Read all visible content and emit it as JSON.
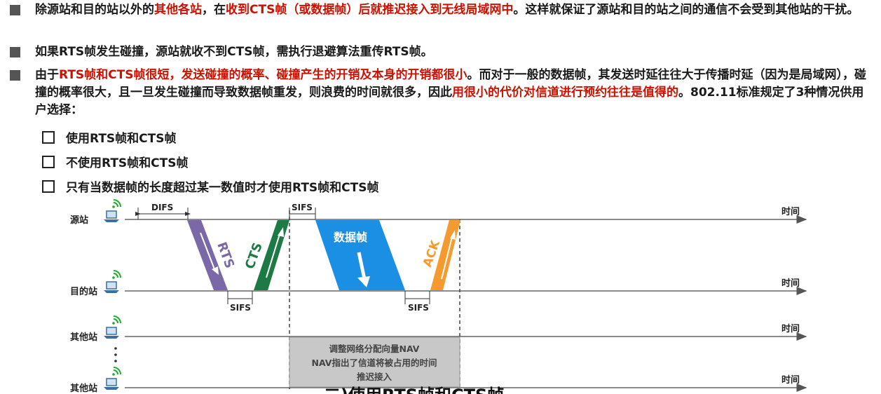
{
  "bullets": [
    {
      "parts": [
        {
          "text": "除源站和目的站以外的",
          "red": false
        },
        {
          "text": "其他各站",
          "red": true
        },
        {
          "text": "，在",
          "red": false
        },
        {
          "text": "收到CTS帧（或数据帧）后就推迟接入到无线局域网中",
          "red": true
        },
        {
          "text": "。这样就保证了源站和目的站之间的通信不会受到其他站的干扰。",
          "red": false
        }
      ]
    },
    {
      "parts": [
        {
          "text": "如果RTS帧发生碰撞，源站就收不到CTS帧，需执行退避算法重传RTS帧。",
          "red": false
        }
      ]
    },
    {
      "parts": [
        {
          "text": "由于",
          "red": false
        },
        {
          "text": "RTS帧和CTS帧很短，发送碰撞的概率、碰撞产生的开销及本身的开销都很小",
          "red": true
        },
        {
          "text": "。而对于一般的数据帧，其发送时延往往大于传播时延（因为是局域网），碰撞的概率很大，且一旦发生碰撞而导致数据帧重发，则浪费的时间就很多，因此",
          "red": false
        },
        {
          "text": "用很小的代价对信道进行预约往往是值得的",
          "red": true
        },
        {
          "text": "。802.11标准规定了3种情况供用户选择：",
          "red": false
        }
      ]
    }
  ],
  "options": [
    "使用RTS帧和CTS帧",
    "不使用RTS帧和CTS帧",
    "只有当数据帧的长度超过某一数值时才使用RTS帧和CTS帧"
  ],
  "diagram": {
    "stations": [
      "源站",
      "目的站",
      "其他站",
      "其他站"
    ],
    "time_label": "时间",
    "difs": "DIFS",
    "sifs": "SIFS",
    "frames": {
      "rts": "RTS",
      "cts": "CTS",
      "data": "数据帧",
      "ack": "ACK"
    },
    "nav_lines": [
      "调整网络分配向量NAV",
      "NAV指出了信道将被占用的时间",
      "推迟接入"
    ],
    "colors": {
      "rts": "#7b68a6",
      "cts": "#1e7a45",
      "data": "#1a8fe3",
      "ack": "#f59a2e",
      "nav": "#c8c8c8",
      "red_text": "#cc1100"
    }
  },
  "caption": "二)使用RTS帧和CTS帧"
}
